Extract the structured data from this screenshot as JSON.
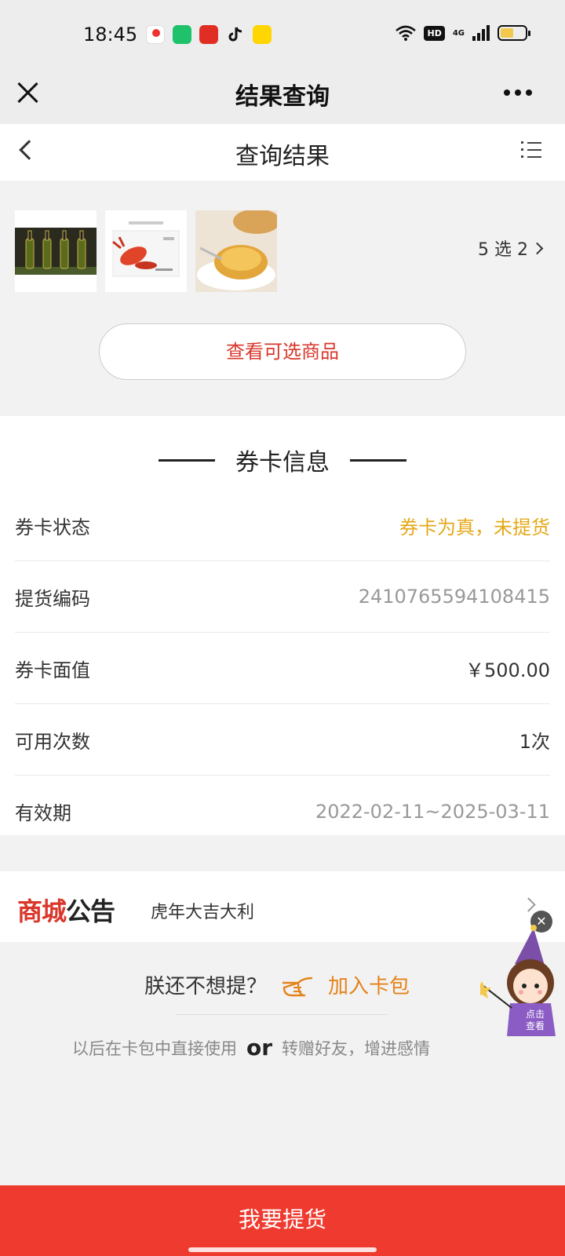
{
  "status": {
    "time": "18:45",
    "network": "4G",
    "hd": "HD"
  },
  "topbar": {
    "title": "结果查询"
  },
  "page_header": {
    "title": "查询结果"
  },
  "products": {
    "pick_label": "5 选 2"
  },
  "view_button": {
    "label": "查看可选商品"
  },
  "card_info": {
    "title": "券卡信息",
    "rows": [
      {
        "label": "券卡状态",
        "value": "券卡为真，未提货"
      },
      {
        "label": "提货编码",
        "value": "2410765594108415"
      },
      {
        "label": "券卡面值",
        "value": "￥500.00"
      },
      {
        "label": "可用次数",
        "value": "1次"
      },
      {
        "label": "有效期",
        "value": "2022-02-11~2025-03-11"
      }
    ]
  },
  "notice": {
    "logo_a": "商城",
    "logo_b": "公告",
    "text": "虎年大吉大利"
  },
  "promo": {
    "question": "朕还不想提？",
    "join_label": "加入卡包",
    "sub_left": "以后在卡包中直接使用",
    "or": "or",
    "sub_right": "转赠好友，增进感情"
  },
  "mascot": {
    "line1": "点击",
    "line2": "查看"
  },
  "cta": {
    "label": "我要提货"
  },
  "colors": {
    "accent_red": "#ef3b2f",
    "status_gold": "#e5a817",
    "join_orange": "#e5831a"
  }
}
